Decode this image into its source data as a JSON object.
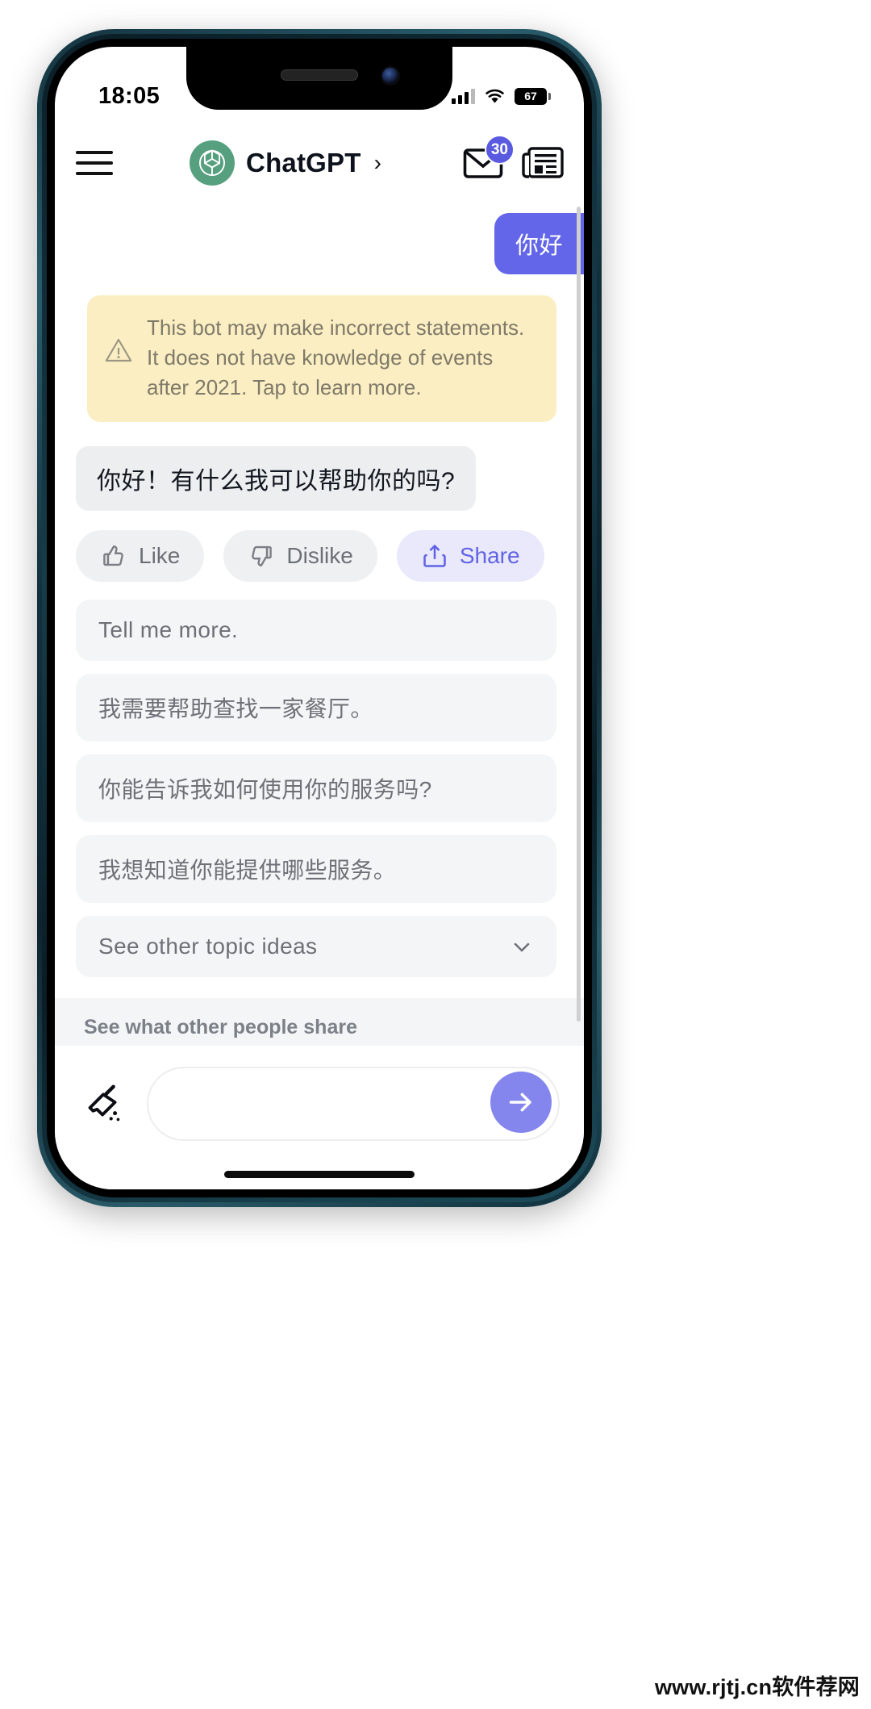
{
  "status_bar": {
    "time": "18:05",
    "battery_level": "67",
    "signal_icon": "cellular-bars-icon",
    "wifi_icon": "wifi-icon",
    "battery_icon": "battery-icon"
  },
  "header": {
    "menu_icon": "hamburger-menu-icon",
    "logo_icon": "openai-logo-icon",
    "title": "ChatGPT",
    "chevron": "›",
    "mail_icon": "mail-envelope-icon",
    "mail_badge": "30",
    "news_icon": "news-article-icon"
  },
  "conversation": {
    "user_message": "你好",
    "notice": {
      "icon": "warning-triangle-icon",
      "text": "This bot may make incorrect statements. It does not have knowledge of events after 2021.  Tap to learn more."
    },
    "bot_message": "你好！有什么我可以帮助你的吗?"
  },
  "actions": [
    {
      "id": "like",
      "label": "Like",
      "icon": "thumbs-up-icon",
      "style": "neutral"
    },
    {
      "id": "dislike",
      "label": "Dislike",
      "icon": "thumbs-down-icon",
      "style": "neutral"
    },
    {
      "id": "share",
      "label": "Share",
      "icon": "share-icon",
      "style": "accent"
    }
  ],
  "suggestions": [
    "Tell me more.",
    "我需要帮助查找一家餐厅。",
    "你能告诉我如何使用你的服务吗?",
    "我想知道你能提供哪些服务。"
  ],
  "more_topics": {
    "label": "See other topic ideas",
    "chevron_icon": "chevron-down-icon"
  },
  "share_panel": {
    "title": "See what other people share",
    "loading_icon": "loading-spinner-icon"
  },
  "input_bar": {
    "broom_icon": "broom-clear-icon",
    "value": "",
    "placeholder": "",
    "send_icon": "arrow-right-send-icon"
  },
  "watermark": "www.rjtj.cn软件荐网",
  "colors": {
    "accent_purple": "#6366e8",
    "send_purple": "#8486ee",
    "share_bg": "#e9e9fb",
    "notice_bg": "#fbeec2",
    "bubble_gray": "#eceef0",
    "suggestion_gray": "#f4f5f6",
    "logo_green": "#56a07f",
    "phone_frame": "#163d4a"
  }
}
